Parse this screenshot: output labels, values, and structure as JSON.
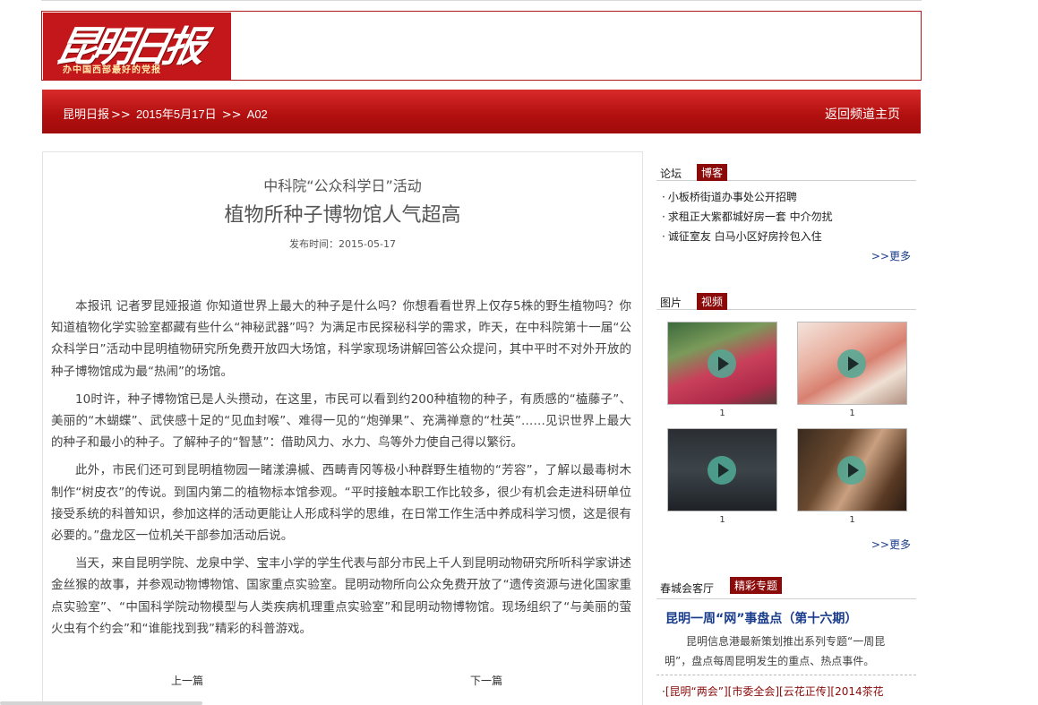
{
  "header": {
    "logo_text": "昆明日报",
    "logo_slogan": "办中国西部最好的党报"
  },
  "nav": {
    "crumb_site": "昆明日报",
    "crumb_sep1": ">>",
    "crumb_date": "2015年5月17日",
    "crumb_sep2": ">>",
    "crumb_page": "A02",
    "back_label": "返回频道主页"
  },
  "article": {
    "kicker": "中科院“公众科学日”活动",
    "headline": "植物所种子博物馆人气超高",
    "pubtime": "发布时间：2015-05-17",
    "paragraphs": [
      "本报讯 记者罗昆娅报道 你知道世界上最大的种子是什么吗？你想看看世界上仅存5株的野生植物吗？你知道植物化学实验室都藏有些什么“神秘武器”吗？为满足市民探秘科学的需求，昨天，在中科院第十一届“公众科学日”活动中昆明植物研究所免费开放四大场馆，科学家现场讲解回答公众提问，其中平时不对外开放的种子博物馆成为最“热闹”的场馆。",
      "10时许，种子博物馆已是人头攒动，在这里，市民可以看到约200种植物的种子，有质感的“榼藤子”、美丽的“木蝴蝶”、武侠感十足的“见血封喉”、难得一见的“炮弹果”、充满禅意的“杜英”……见识世界上最大的种子和最小的种子。了解种子的“智慧”：借助风力、水力、鸟等外力使自己得以繁衍。",
      "此外，市民们还可到昆明植物园一睹漾濞槭、西畴青冈等极小种群野生植物的“芳容”，了解以最毒树木制作“树皮衣”的传说。到国内第二的植物标本馆参观。“平时接触本职工作比较多，很少有机会走进科研单位接受系统的科普知识，参加这样的活动更能让人形成科学的思维，在日常工作生活中养成科学习惯，这是很有必要的。”盘龙区一位机关干部参加活动后说。",
      "当天，来自昆明学院、龙泉中学、宝丰小学的学生代表与部分市民上千人到昆明动物研究所听科学家讲述金丝猴的故事，并参观动物博物馆、国家重点实验室。昆明动物所向公众免费开放了“遗传资源与进化国家重点实验室”、“中国科学院动物模型与人类疾病机理重点实验室”和昆明动物博物馆。现场组织了“与美丽的萤火虫有个约会”和“谁能找到我”精彩的科普游戏。"
    ],
    "prev_label": "上一篇",
    "next_label": "下一篇"
  },
  "sidebar": {
    "forum": {
      "label": "论坛",
      "tab": "博客",
      "items": [
        "小板桥街道办事处公开招聘",
        "求租正大紫都城好房一套 中介勿扰",
        "诚征室友 白马小区好房拎包入住"
      ],
      "more": ">>更多"
    },
    "media": {
      "label": "图片",
      "tab": "视频",
      "captions": [
        "1",
        "1",
        "1",
        "1"
      ],
      "more": ">>更多"
    },
    "feature": {
      "label": "春城会客厅",
      "tab": "精彩专题",
      "title": "昆明一周“网”事盘点（第十六期）",
      "desc": "昆明信息港最新策划推出系列专题“一周昆明”，盘点每周昆明发生的重点、热点事件。",
      "tags": [
        "[昆明“两会”]",
        "[市委全会]",
        "[云花正传]",
        "[2014茶花"
      ]
    }
  },
  "colors": {
    "brand_red": "#c4171b",
    "tab_red": "#8b0a0a",
    "link_blue": "#1a3c8c"
  }
}
